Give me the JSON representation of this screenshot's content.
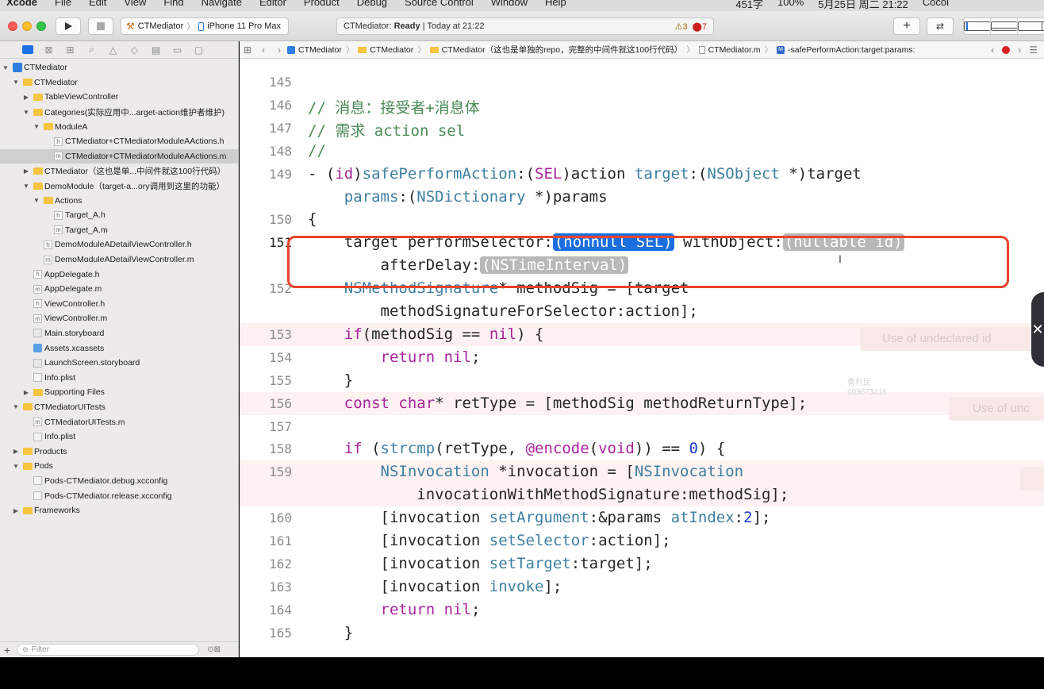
{
  "menubar": {
    "app_name": "Xcode",
    "items": [
      "File",
      "Edit",
      "View",
      "Find",
      "Navigate",
      "Editor",
      "Product",
      "Debug",
      "Source Control",
      "Window",
      "Help"
    ],
    "status_right": [
      "451字",
      "100%",
      "5月25日 周二 21:22",
      "Cocoi"
    ]
  },
  "toolbar": {
    "scheme": "CTMediator",
    "device": "iPhone 11 Pro Max",
    "activity_project": "CTMediator:",
    "activity_status": "Ready",
    "activity_time": "| Today at 21:22",
    "warning_count": "3",
    "error_count": "7",
    "library_icon": "plus-icon",
    "review_icon": "arrows-icon"
  },
  "navigator": {
    "filter_placeholder": "Filter",
    "tree": [
      {
        "label": "CTMediator",
        "depth": 0,
        "kind": "proj",
        "open": true
      },
      {
        "label": "CTMediator",
        "depth": 1,
        "kind": "folder",
        "open": true
      },
      {
        "label": "TableViewController",
        "depth": 2,
        "kind": "folder",
        "open": false
      },
      {
        "label": "Categories(实际应用中...arget-action维护者维护)",
        "depth": 2,
        "kind": "folder",
        "open": true
      },
      {
        "label": "ModuleA",
        "depth": 3,
        "kind": "folder",
        "open": true
      },
      {
        "label": "CTMediator+CTMediatorModuleAActions.h",
        "depth": 4,
        "kind": "doc",
        "mark": "h"
      },
      {
        "label": "CTMediator+CTMediatorModuleAActions.m",
        "depth": 4,
        "kind": "doc",
        "mark": "m",
        "selected": true
      },
      {
        "label": "CTMediator（这也是单...中间件就这100行代码）",
        "depth": 2,
        "kind": "folder",
        "open": false
      },
      {
        "label": "DemoModule（target-a...ory调用到这里的功能）",
        "depth": 2,
        "kind": "folder",
        "open": true
      },
      {
        "label": "Actions",
        "depth": 3,
        "kind": "folder",
        "open": true
      },
      {
        "label": "Target_A.h",
        "depth": 4,
        "kind": "doc",
        "mark": "h"
      },
      {
        "label": "Target_A.m",
        "depth": 4,
        "kind": "doc",
        "mark": "m"
      },
      {
        "label": "DemoModuleADetailViewController.h",
        "depth": 3,
        "kind": "doc",
        "mark": "h"
      },
      {
        "label": "DemoModuleADetailViewController.m",
        "depth": 3,
        "kind": "doc",
        "mark": "m"
      },
      {
        "label": "AppDelegate.h",
        "depth": 2,
        "kind": "doc",
        "mark": "h"
      },
      {
        "label": "AppDelegate.m",
        "depth": 2,
        "kind": "doc",
        "mark": "m"
      },
      {
        "label": "ViewController.h",
        "depth": 2,
        "kind": "doc",
        "mark": "h"
      },
      {
        "label": "ViewController.m",
        "depth": 2,
        "kind": "doc",
        "mark": "m"
      },
      {
        "label": "Main.storyboard",
        "depth": 2,
        "kind": "storyboard"
      },
      {
        "label": "Assets.xcassets",
        "depth": 2,
        "kind": "xcassets"
      },
      {
        "label": "LaunchScreen.storyboard",
        "depth": 2,
        "kind": "storyboard"
      },
      {
        "label": "Info.plist",
        "depth": 2,
        "kind": "plist"
      },
      {
        "label": "Supporting Files",
        "depth": 2,
        "kind": "folder",
        "open": false
      },
      {
        "label": "CTMediatorUITests",
        "depth": 1,
        "kind": "folder",
        "open": true
      },
      {
        "label": "CTMediatorUITests.m",
        "depth": 2,
        "kind": "doc",
        "mark": "m"
      },
      {
        "label": "Info.plist",
        "depth": 2,
        "kind": "plist"
      },
      {
        "label": "Products",
        "depth": 1,
        "kind": "folder",
        "open": false
      },
      {
        "label": "Pods",
        "depth": 1,
        "kind": "folder",
        "open": true
      },
      {
        "label": "Pods-CTMediator.debug.xcconfig",
        "depth": 2,
        "kind": "plist"
      },
      {
        "label": "Pods-CTMediator.release.xcconfig",
        "depth": 2,
        "kind": "plist"
      },
      {
        "label": "Frameworks",
        "depth": 1,
        "kind": "folder",
        "open": false
      }
    ]
  },
  "jumpbar": {
    "crumbs": [
      {
        "label": "CTMediator",
        "icon": "proj"
      },
      {
        "label": "CTMediator",
        "icon": "folder"
      },
      {
        "label": "CTMediator（这也是单独的repo，完整的中间件就这100行代码）",
        "icon": "folder"
      },
      {
        "label": "CTMediator.m",
        "icon": "file"
      },
      {
        "label": "-safePerformAction:target:params:",
        "icon": "method"
      }
    ],
    "method_badge": "M"
  },
  "editor": {
    "lines": [
      {
        "no": "145",
        "html": ""
      },
      {
        "no": "146",
        "html": "<span class='cm'>// 消息：接受者+消息体</span>"
      },
      {
        "no": "147",
        "html": "<span class='cm'>// 需求 action sel</span>"
      },
      {
        "no": "148",
        "html": "<span class='cm'>//</span>"
      },
      {
        "no": "149",
        "html": "- (<span class='kw'>id</span>)<span class='fn'>safePerformAction</span>:(<span class='kw'>SEL</span>)action <span class='fn'>target</span>:(<span class='ty'>NSObject</span> *)target"
      },
      {
        "no": "",
        "html": "    <span class='fn'>params</span>:(<span class='ty'>NSDictionary</span> *)params"
      },
      {
        "no": "150",
        "html": "{"
      },
      {
        "no": "151",
        "html": "    target performSelector:<span class='ph-sel'>(nonnull SEL)</span> withObject:<span class='ph'>(nullable id)</span>",
        "current": true
      },
      {
        "no": "",
        "html": "        afterDelay:<span class='ph'>(NSTimeInterval)</span>"
      },
      {
        "no": "152",
        "html": "    <span class='ty'>NSMethodSignature</span>* methodSig = [target"
      },
      {
        "no": "",
        "html": "        methodSignatureForSelector:action];"
      },
      {
        "no": "153",
        "html": "    <span class='kw'>if</span>(methodSig == <span class='kw'>nil</span>) {",
        "err": true
      },
      {
        "no": "154",
        "html": "        <span class='kw'>return</span> <span class='kw'>nil</span>;"
      },
      {
        "no": "155",
        "html": "    }"
      },
      {
        "no": "156",
        "html": "    <span class='kw'>const</span> <span class='kw'>char</span>* retType = [methodSig methodReturnType];",
        "err": true
      },
      {
        "no": "157",
        "html": ""
      },
      {
        "no": "158",
        "html": "    <span class='kw'>if</span> (<span class='fn'>strcmp</span>(retType, <span class='kw'>@encode</span>(<span class='kw'>void</span>)) == <span class='num'>0</span>) {"
      },
      {
        "no": "159",
        "html": "        <span class='ty'>NSInvocation</span> *invocation = [<span class='ty'>NSInvocation</span>",
        "err": true
      },
      {
        "no": "",
        "html": "            invocationWithMethodSignature:methodSig];",
        "err": true
      },
      {
        "no": "160",
        "html": "        [invocation <span class='fn'>setArgument</span>:&amp;params <span class='fn'>atIndex</span>:<span class='num'>2</span>];"
      },
      {
        "no": "161",
        "html": "        [invocation <span class='fn'>setSelector</span>:action];"
      },
      {
        "no": "162",
        "html": "        [invocation <span class='fn'>setTarget</span>:target];"
      },
      {
        "no": "163",
        "html": "        [invocation <span class='fn'>invoke</span>];"
      },
      {
        "no": "164",
        "html": "        <span class='kw'>return</span> <span class='kw'>nil</span>;"
      },
      {
        "no": "165",
        "html": "    }"
      }
    ],
    "error_hints": [
      "Use of undeclared id",
      "Use of unc"
    ],
    "watermark": [
      "曹利民",
      "693673416"
    ]
  },
  "colors": {
    "accent": "#1f6fe5",
    "highlight_box": "#e8432b",
    "error_line": "#fdf1f1"
  }
}
